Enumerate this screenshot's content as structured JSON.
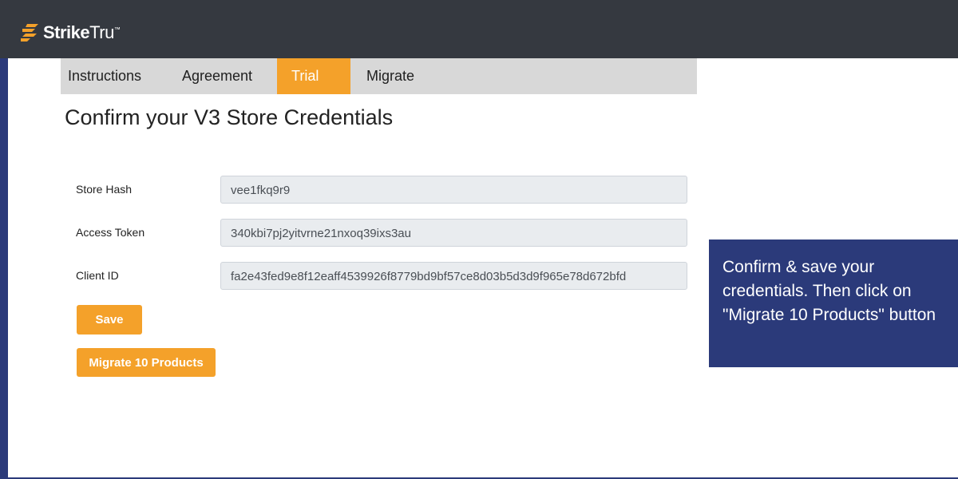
{
  "brand": {
    "name_bold": "Strike",
    "name_light": "Tru",
    "trademark": "™"
  },
  "tabs": [
    {
      "label": "Instructions",
      "active": false
    },
    {
      "label": "Agreement",
      "active": false
    },
    {
      "label": "Trial",
      "active": true
    },
    {
      "label": "Migrate",
      "active": false
    }
  ],
  "page": {
    "title": "Confirm your V3 Store Credentials"
  },
  "form": {
    "store_hash": {
      "label": "Store Hash",
      "value": "vee1fkq9r9"
    },
    "access_token": {
      "label": "Access Token",
      "value": "340kbi7pj2yitvrne21nxoq39ixs3au"
    },
    "client_id": {
      "label": "Client ID",
      "value": "fa2e43fed9e8f12eaff4539926f8779bd9bf57ce8d03b5d3d9f965e78d672bfd"
    }
  },
  "buttons": {
    "save": "Save",
    "migrate": "Migrate 10 Products"
  },
  "callout": {
    "text": "Confirm & save your credentials. Then click on \"Migrate 10 Products\" button"
  },
  "colors": {
    "accent": "#f4a12a",
    "topbar": "#353940",
    "callout": "#2b3a7a"
  }
}
